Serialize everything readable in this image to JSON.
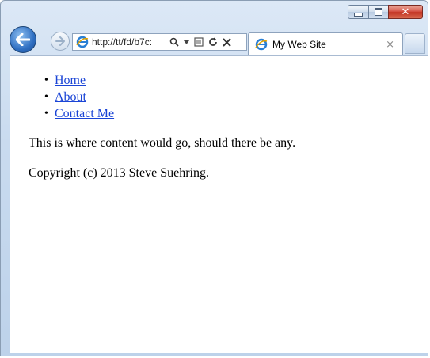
{
  "browser": {
    "address_url": "http://tt/fd/b7c:",
    "tab_title": "My Web Site",
    "tab_close": "×"
  },
  "icons": {
    "back": "back-arrow-icon",
    "forward": "forward-arrow-icon",
    "ie": "ie-logo-icon",
    "search": "search-icon",
    "compat": "compatibility-view-icon",
    "refresh": "refresh-icon",
    "stop": "stop-icon",
    "minimize": "minimize-icon",
    "maximize": "maximize-icon",
    "close": "close-icon"
  },
  "page": {
    "nav": [
      {
        "label": "Home"
      },
      {
        "label": "About"
      },
      {
        "label": "Contact Me"
      }
    ],
    "content": "This is where content would go, should there be any.",
    "copyright": "Copyright (c) 2013 Steve Suehring."
  },
  "colors": {
    "link": "#1a44d6",
    "close_button": "#c23322",
    "chrome": "#c9dbef"
  }
}
